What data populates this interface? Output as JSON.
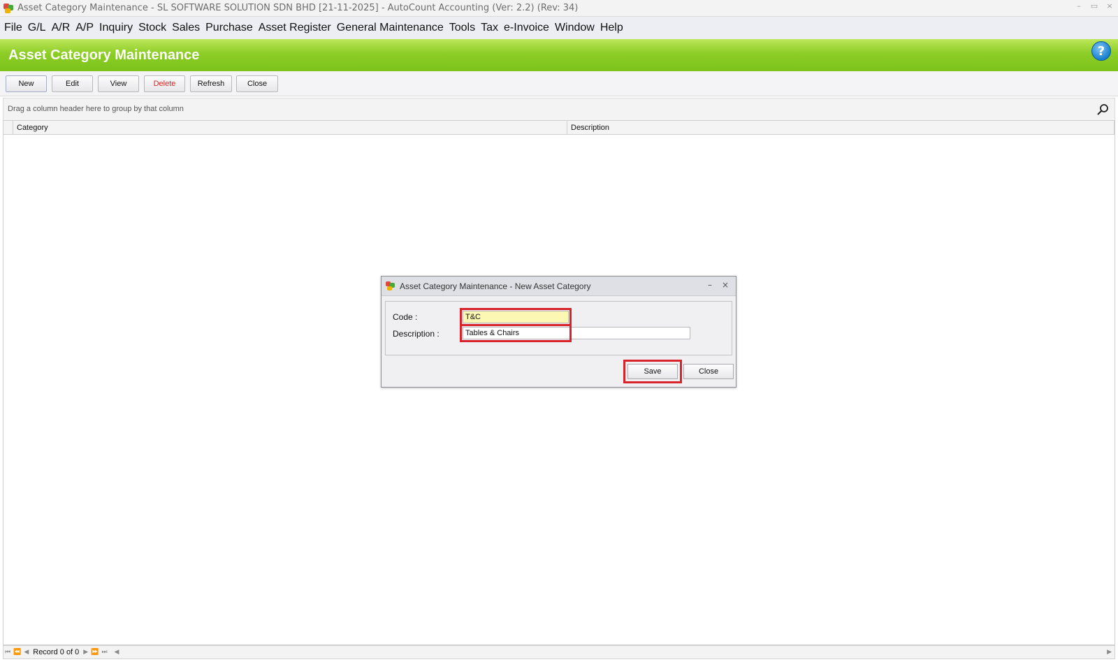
{
  "window": {
    "title": "Asset Category Maintenance - SL SOFTWARE SOLUTION SDN BHD [21-11-2025] - AutoCount Accounting (Ver: 2.2) (Rev: 34)",
    "controls": {
      "minimize": "–",
      "restore": "▭",
      "close": "×"
    }
  },
  "menu": {
    "items": [
      "File",
      "G/L",
      "A/R",
      "A/P",
      "Inquiry",
      "Stock",
      "Sales",
      "Purchase",
      "Asset Register",
      "General Maintenance",
      "Tools",
      "Tax",
      "e-Invoice",
      "Window",
      "Help"
    ]
  },
  "header": {
    "title": "Asset Category Maintenance",
    "help_glyph": "?",
    "accent_color": "#8ccd26"
  },
  "toolbar": {
    "new": "New",
    "edit": "Edit",
    "view": "View",
    "delete": "Delete",
    "refresh": "Refresh",
    "close": "Close"
  },
  "grid": {
    "group_hint": "Drag a column header here to group by that column",
    "columns": [
      "Category",
      "Description"
    ],
    "rows": [],
    "record_text": "Record 0 of 0"
  },
  "dialog": {
    "title": "Asset Category Maintenance - New Asset Category",
    "minimize": "–",
    "close_glyph": "×",
    "code_label": "Code :",
    "code_value": "T&C",
    "description_label": "Description :",
    "description_value": "Tables & Chairs",
    "save": "Save",
    "close": "Close",
    "highlight_color": "#d8232b"
  }
}
